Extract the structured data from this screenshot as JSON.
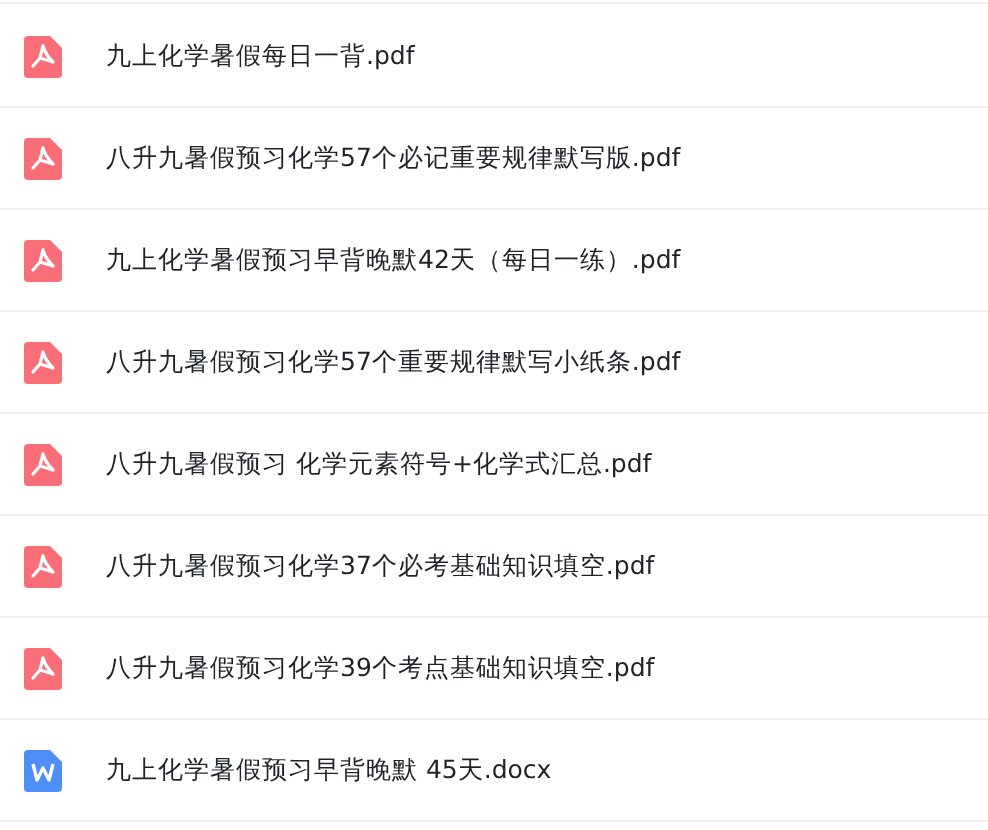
{
  "files": [
    {
      "name": "九上化学暑假每日一背.pdf",
      "kind": "pdf"
    },
    {
      "name": "八升九暑假预习化学57个必记重要规律默写版.pdf",
      "kind": "pdf"
    },
    {
      "name": "九上化学暑假预习早背晚默42天（每日一练）.pdf",
      "kind": "pdf"
    },
    {
      "name": "八升九暑假预习化学57个重要规律默写小纸条.pdf",
      "kind": "pdf"
    },
    {
      "name": "八升九暑假预习 化学元素符号+化学式汇总.pdf",
      "kind": "pdf"
    },
    {
      "name": "八升九暑假预习化学37个必考基础知识填空.pdf",
      "kind": "pdf"
    },
    {
      "name": "八升九暑假预习化学39个考点基础知识填空.pdf",
      "kind": "pdf"
    },
    {
      "name": "九上化学暑假预习早背晚默 45天.docx",
      "kind": "doc"
    }
  ]
}
